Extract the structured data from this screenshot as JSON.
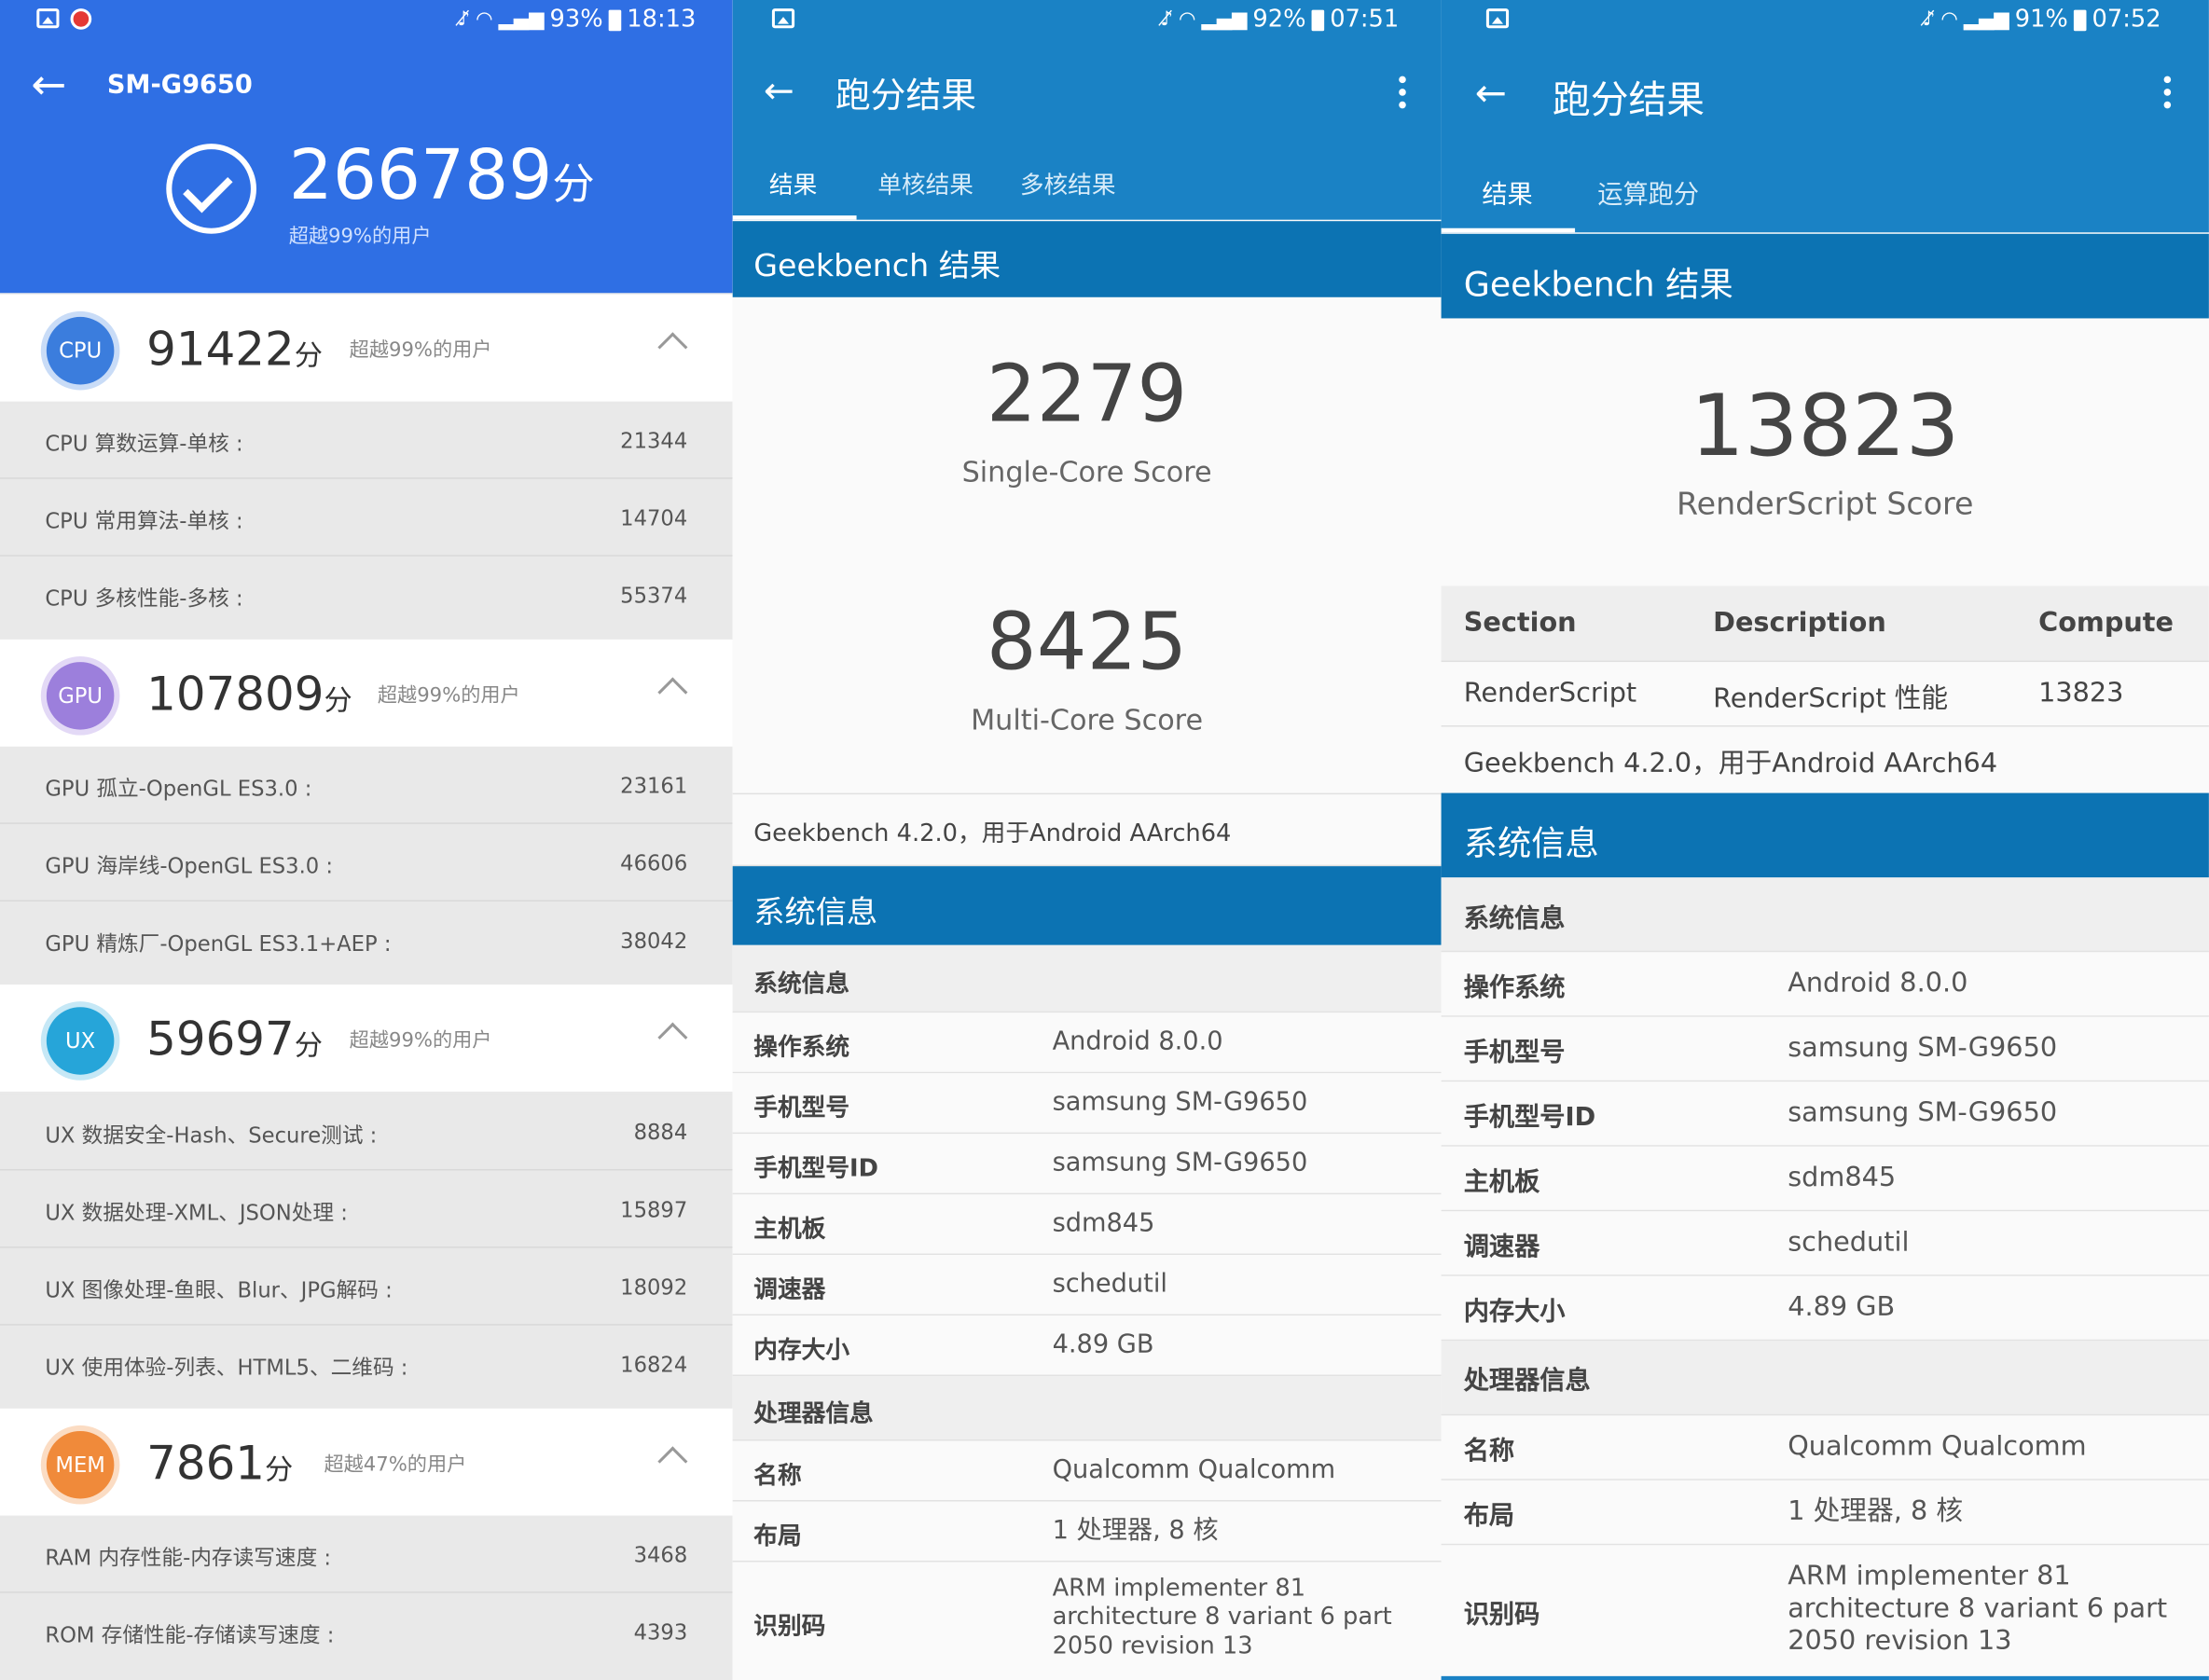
{
  "antutu": {
    "status": {
      "battery": "93%",
      "time": "18:13"
    },
    "device": "SM-G9650",
    "total_score": "266789",
    "score_unit": "分",
    "total_percentile": "超越99%的用户",
    "categories": [
      {
        "badge": "CPU",
        "color": "#3b7ddd",
        "score": "91422",
        "unit": "分",
        "percentile": "超越99%的用户",
        "items": [
          {
            "label": "CPU 算数运算-单核 :",
            "value": "21344"
          },
          {
            "label": "CPU 常用算法-单核 :",
            "value": "14704"
          },
          {
            "label": "CPU 多核性能-多核 :",
            "value": "55374"
          }
        ]
      },
      {
        "badge": "GPU",
        "color": "#9c7fdc",
        "score": "107809",
        "unit": "分",
        "percentile": "超越99%的用户",
        "items": [
          {
            "label": "GPU 孤立-OpenGL ES3.0 :",
            "value": "23161"
          },
          {
            "label": "GPU 海岸线-OpenGL ES3.0 :",
            "value": "46606"
          },
          {
            "label": "GPU 精炼厂-OpenGL ES3.1+AEP :",
            "value": "38042"
          }
        ]
      },
      {
        "badge": "UX",
        "color": "#26a5d9",
        "score": "59697",
        "unit": "分",
        "percentile": "超越99%的用户",
        "items": [
          {
            "label": "UX 数据安全-Hash、Secure测试 :",
            "value": "8884"
          },
          {
            "label": "UX 数据处理-XML、JSON处理 :",
            "value": "15897"
          },
          {
            "label": "UX 图像处理-鱼眼、Blur、JPG解码 :",
            "value": "18092"
          },
          {
            "label": "UX 使用体验-列表、HTML5、二维码 :",
            "value": "16824"
          }
        ]
      },
      {
        "badge": "MEM",
        "color": "#f08a3a",
        "score": "7861",
        "unit": "分",
        "percentile": "超越47%的用户",
        "items": [
          {
            "label": "RAM 内存性能-内存读写速度 :",
            "value": "3468"
          },
          {
            "label": "ROM 存储性能-存储读写速度 :",
            "value": "4393"
          }
        ]
      }
    ]
  },
  "gb_cpu": {
    "status": {
      "battery": "92%",
      "time": "07:51"
    },
    "title": "跑分结果",
    "tabs": [
      "结果",
      "单核结果",
      "多核结果"
    ],
    "section_title": "Geekbench 结果",
    "single_score": "2279",
    "single_label": "Single-Core Score",
    "multi_score": "8425",
    "multi_label": "Multi-Core Score",
    "version": "Geekbench 4.2.0，用于Android AArch64",
    "sysinfo_title": "系统信息",
    "sysinfo_sub": "系统信息",
    "rows": [
      {
        "k": "操作系统",
        "v": "Android 8.0.0"
      },
      {
        "k": "手机型号",
        "v": "samsung SM-G9650"
      },
      {
        "k": "手机型号ID",
        "v": "samsung SM-G9650"
      },
      {
        "k": "主机板",
        "v": "sdm845"
      },
      {
        "k": "调速器",
        "v": "schedutil"
      },
      {
        "k": "内存大小",
        "v": "4.89 GB"
      }
    ],
    "cpu_sub": "处理器信息",
    "cpu_rows": [
      {
        "k": "名称",
        "v": "Qualcomm Qualcomm"
      },
      {
        "k": "布局",
        "v": "1 处理器, 8 核"
      },
      {
        "k": "识别码",
        "v": "ARM implementer 81 architecture 8 variant 6 part 2050 revision 13"
      }
    ]
  },
  "gb_compute": {
    "status": {
      "battery": "91%",
      "time": "07:52"
    },
    "title": "跑分结果",
    "tabs": [
      "结果",
      "运算跑分"
    ],
    "section_title": "Geekbench 结果",
    "score": "13823",
    "score_label": "RenderScript Score",
    "table_headers": [
      "Section",
      "Description",
      "Compute"
    ],
    "table_row": {
      "section": "RenderScript",
      "description": "RenderScript 性能",
      "compute": "13823"
    },
    "version": "Geekbench 4.2.0，用于Android AArch64",
    "sysinfo_title": "系统信息",
    "sysinfo_sub": "系统信息",
    "rows": [
      {
        "k": "操作系统",
        "v": "Android 8.0.0"
      },
      {
        "k": "手机型号",
        "v": "samsung SM-G9650"
      },
      {
        "k": "手机型号ID",
        "v": "samsung SM-G9650"
      },
      {
        "k": "主机板",
        "v": "sdm845"
      },
      {
        "k": "调速器",
        "v": "schedutil"
      },
      {
        "k": "内存大小",
        "v": "4.89 GB"
      }
    ],
    "cpu_sub": "处理器信息",
    "cpu_rows": [
      {
        "k": "名称",
        "v": "Qualcomm Qualcomm"
      },
      {
        "k": "布局",
        "v": "1 处理器, 8 核"
      },
      {
        "k": "识别码",
        "v": "ARM implementer 81 architecture 8 variant 6 part 2050 revision 13"
      }
    ]
  }
}
